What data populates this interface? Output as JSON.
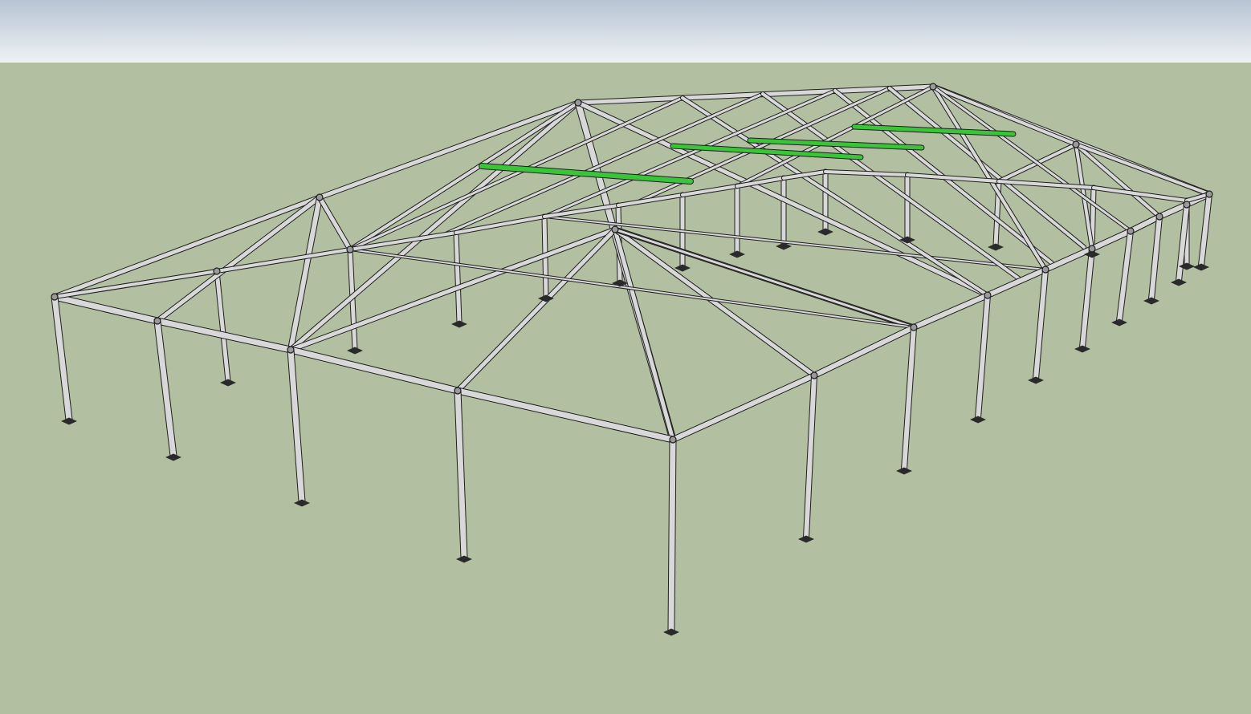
{
  "viewport": {
    "sky_top_color": "#b7c4d3",
    "sky_bottom_color": "#eef1f5",
    "ground_color": "#b2bfa1"
  },
  "model": {
    "subject": "frame tent",
    "pipe_fill_color": "#d8d8d8",
    "pipe_outline_color": "#1e1e1e",
    "purlin_highlight_color": "#39c43a",
    "footplate_color": "#2a2a2a"
  }
}
